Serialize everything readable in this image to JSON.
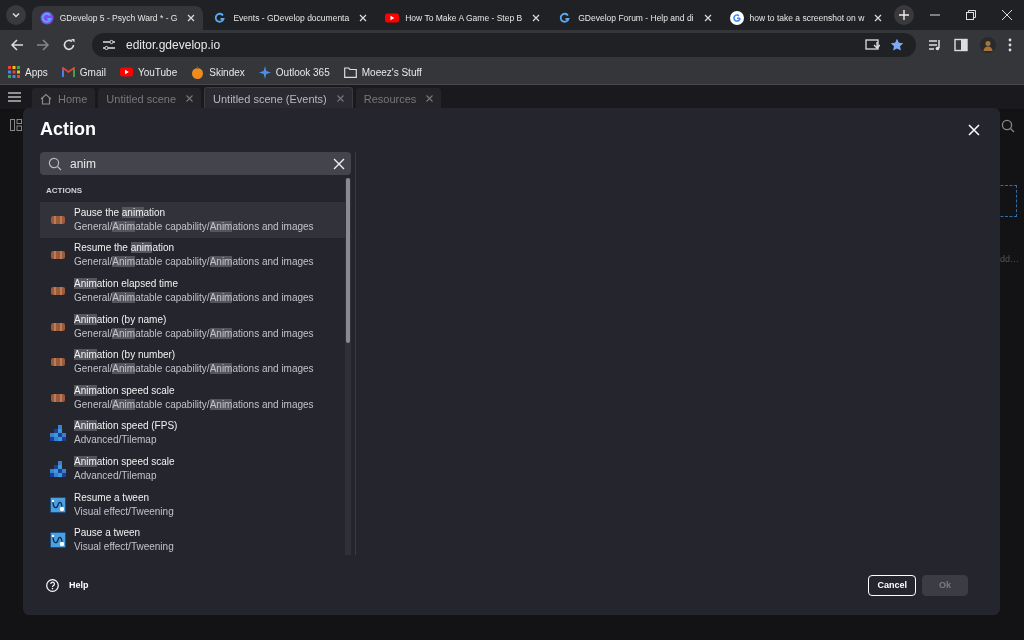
{
  "browser_tabs": [
    {
      "title": "GDevelop 5 - Psych Ward * - G",
      "kind": "gdevelop",
      "selected": true
    },
    {
      "title": "Events - GDevelop documenta",
      "kind": "gdevelop",
      "selected": false
    },
    {
      "title": "How To Make A Game - Step B",
      "kind": "youtube",
      "selected": false
    },
    {
      "title": "GDevelop Forum - Help and di",
      "kind": "gdevelop",
      "selected": false
    },
    {
      "title": "how to take a screenshot on w",
      "kind": "google",
      "selected": false
    }
  ],
  "address_bar": {
    "url": "editor.gdevelop.io"
  },
  "bookmarks": [
    {
      "label": "Apps",
      "kind": "apps"
    },
    {
      "label": "Gmail",
      "kind": "gmail"
    },
    {
      "label": "YouTube",
      "kind": "youtube"
    },
    {
      "label": "Skindex",
      "kind": "skindex"
    },
    {
      "label": "Outlook 365",
      "kind": "outlook"
    },
    {
      "label": "Moeez's Stuff",
      "kind": "folder"
    }
  ],
  "editor_tabs": [
    {
      "label": "Home",
      "kind": "home",
      "closable": false,
      "selected": false
    },
    {
      "label": "Untitled scene",
      "closable": true,
      "selected": false
    },
    {
      "label": "Untitled scene (Events)",
      "closable": true,
      "selected": true
    },
    {
      "label": "Resources",
      "closable": true,
      "selected": false
    }
  ],
  "background": {
    "cut_text": "dd…"
  },
  "dialog": {
    "title": "Action",
    "search": {
      "value": "anim"
    },
    "section_header": "ACTIONS",
    "items": [
      {
        "kind": "sprite",
        "selected": true,
        "title": [
          {
            "text": "Pause the ",
            "highlighted": false
          },
          {
            "text": "anim",
            "highlighted": true
          },
          {
            "text": "ation",
            "highlighted": false
          }
        ],
        "path": [
          {
            "text": "General/",
            "highlighted": false
          },
          {
            "text": "Anim",
            "highlighted": true
          },
          {
            "text": "atable capability/",
            "highlighted": false
          },
          {
            "text": "Anim",
            "highlighted": true
          },
          {
            "text": "ations and images",
            "highlighted": false
          }
        ]
      },
      {
        "kind": "sprite",
        "selected": false,
        "title": [
          {
            "text": "Resume the ",
            "highlighted": false
          },
          {
            "text": "anim",
            "highlighted": true
          },
          {
            "text": "ation",
            "highlighted": false
          }
        ],
        "path": [
          {
            "text": "General/",
            "highlighted": false
          },
          {
            "text": "Anim",
            "highlighted": true
          },
          {
            "text": "atable capability/",
            "highlighted": false
          },
          {
            "text": "Anim",
            "highlighted": true
          },
          {
            "text": "ations and images",
            "highlighted": false
          }
        ]
      },
      {
        "kind": "sprite",
        "selected": false,
        "title": [
          {
            "text": "Anim",
            "highlighted": true
          },
          {
            "text": "ation elapsed time",
            "highlighted": false
          }
        ],
        "path": [
          {
            "text": "General/",
            "highlighted": false
          },
          {
            "text": "Anim",
            "highlighted": true
          },
          {
            "text": "atable capability/",
            "highlighted": false
          },
          {
            "text": "Anim",
            "highlighted": true
          },
          {
            "text": "ations and images",
            "highlighted": false
          }
        ]
      },
      {
        "kind": "sprite",
        "selected": false,
        "title": [
          {
            "text": "Anim",
            "highlighted": true
          },
          {
            "text": "ation (by name)",
            "highlighted": false
          }
        ],
        "path": [
          {
            "text": "General/",
            "highlighted": false
          },
          {
            "text": "Anim",
            "highlighted": true
          },
          {
            "text": "atable capability/",
            "highlighted": false
          },
          {
            "text": "Anim",
            "highlighted": true
          },
          {
            "text": "ations and images",
            "highlighted": false
          }
        ]
      },
      {
        "kind": "sprite",
        "selected": false,
        "title": [
          {
            "text": "Anim",
            "highlighted": true
          },
          {
            "text": "ation (by number)",
            "highlighted": false
          }
        ],
        "path": [
          {
            "text": "General/",
            "highlighted": false
          },
          {
            "text": "Anim",
            "highlighted": true
          },
          {
            "text": "atable capability/",
            "highlighted": false
          },
          {
            "text": "Anim",
            "highlighted": true
          },
          {
            "text": "ations and images",
            "highlighted": false
          }
        ]
      },
      {
        "kind": "sprite",
        "selected": false,
        "title": [
          {
            "text": "Anim",
            "highlighted": true
          },
          {
            "text": "ation speed scale",
            "highlighted": false
          }
        ],
        "path": [
          {
            "text": "General/",
            "highlighted": false
          },
          {
            "text": "Anim",
            "highlighted": true
          },
          {
            "text": "atable capability/",
            "highlighted": false
          },
          {
            "text": "Anim",
            "highlighted": true
          },
          {
            "text": "ations and images",
            "highlighted": false
          }
        ]
      },
      {
        "kind": "tilemap",
        "selected": false,
        "title": [
          {
            "text": "Anim",
            "highlighted": true
          },
          {
            "text": "ation speed (FPS)",
            "highlighted": false
          }
        ],
        "path": [
          {
            "text": "Advanced/Tilemap",
            "highlighted": false
          }
        ]
      },
      {
        "kind": "tilemap",
        "selected": false,
        "title": [
          {
            "text": "Anim",
            "highlighted": true
          },
          {
            "text": "ation speed scale",
            "highlighted": false
          }
        ],
        "path": [
          {
            "text": "Advanced/Tilemap",
            "highlighted": false
          }
        ]
      },
      {
        "kind": "tween",
        "selected": false,
        "title": [
          {
            "text": "Resume a tween",
            "highlighted": false
          }
        ],
        "path": [
          {
            "text": "Visual effect/Tweening",
            "highlighted": false
          }
        ]
      },
      {
        "kind": "tween",
        "selected": false,
        "title": [
          {
            "text": "Pause a tween",
            "highlighted": false
          }
        ],
        "path": [
          {
            "text": "Visual effect/Tweening",
            "highlighted": false
          }
        ]
      }
    ],
    "help": "Help",
    "buttons": [
      {
        "label": "Cancel",
        "disabled": false
      },
      {
        "label": "Ok",
        "disabled": true
      }
    ]
  }
}
